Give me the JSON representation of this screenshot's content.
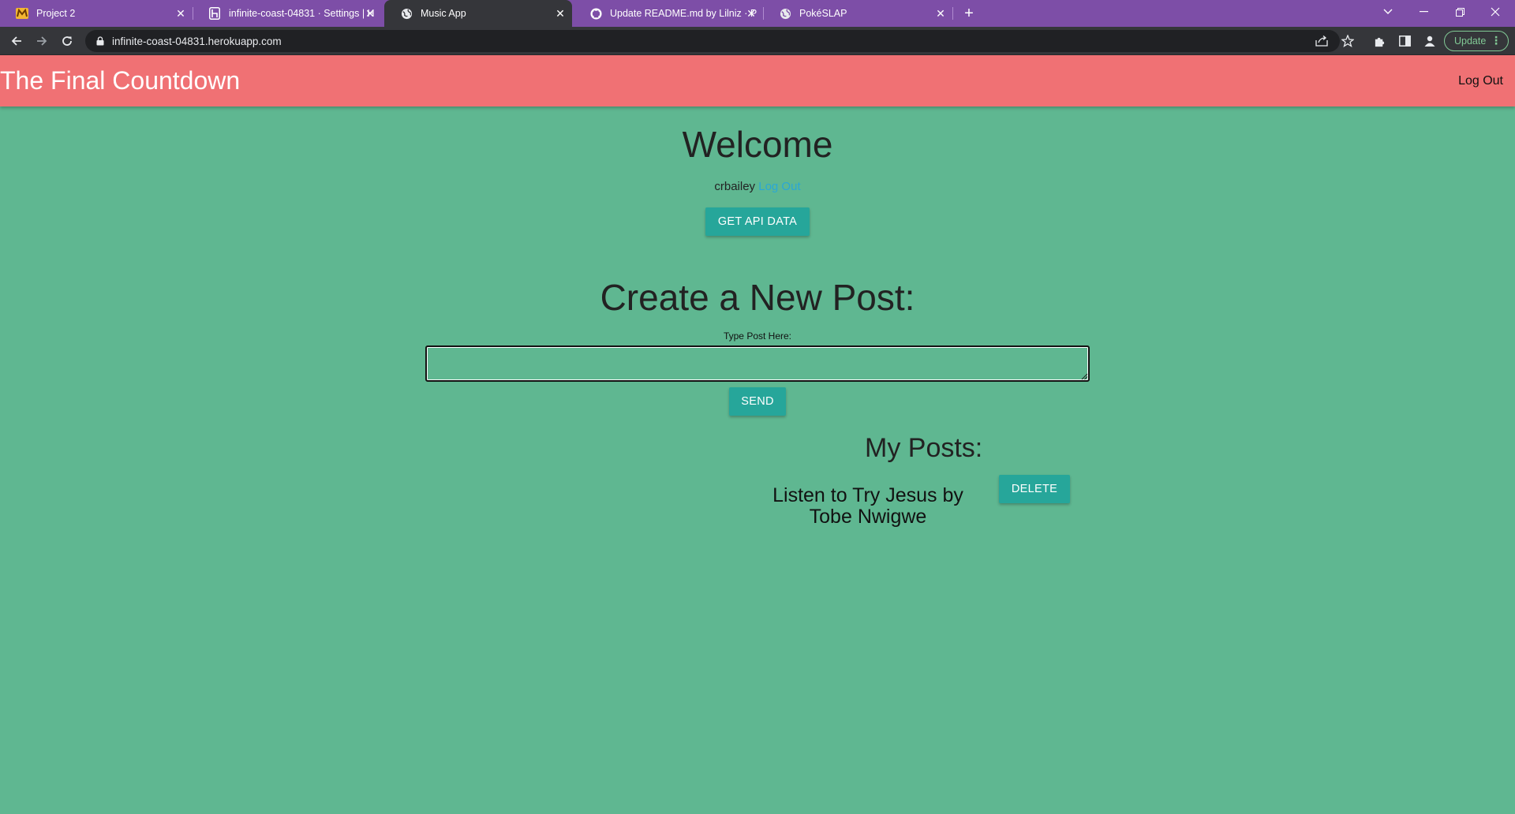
{
  "browser": {
    "tabs": [
      {
        "title": "Project 2",
        "favicon": "mustache-m-icon"
      },
      {
        "title": "infinite-coast-04831 · Settings | H",
        "favicon": "heroku-icon"
      },
      {
        "title": "Music App",
        "favicon": "globe-icon"
      },
      {
        "title": "Update README.md by Lilniz · P",
        "favicon": "github-icon"
      },
      {
        "title": "PokéSLAP",
        "favicon": "globe-icon"
      }
    ],
    "active_tab": 2,
    "url": "infinite-coast-04831.herokuapp.com",
    "update_label": "Update"
  },
  "header": {
    "brand": "The Final Countdown",
    "logout": "Log Out"
  },
  "welcome": {
    "title": "Welcome",
    "username": "crbailey",
    "logout_link": "Log Out",
    "api_button": "GET API DATA"
  },
  "create": {
    "title": "Create a New Post:",
    "label": "Type Post Here:",
    "value": "",
    "send_button": "SEND"
  },
  "posts": {
    "title": "My Posts:",
    "items": [
      {
        "text": "Listen to Try Jesus by Tobe Nwigwe",
        "delete_label": "DELETE"
      }
    ]
  },
  "colors": {
    "tabbar": "#7d4ea7",
    "header": "#f07174",
    "page_bg": "#5fb791",
    "button": "#26a69a",
    "link": "#2aa7d6"
  }
}
